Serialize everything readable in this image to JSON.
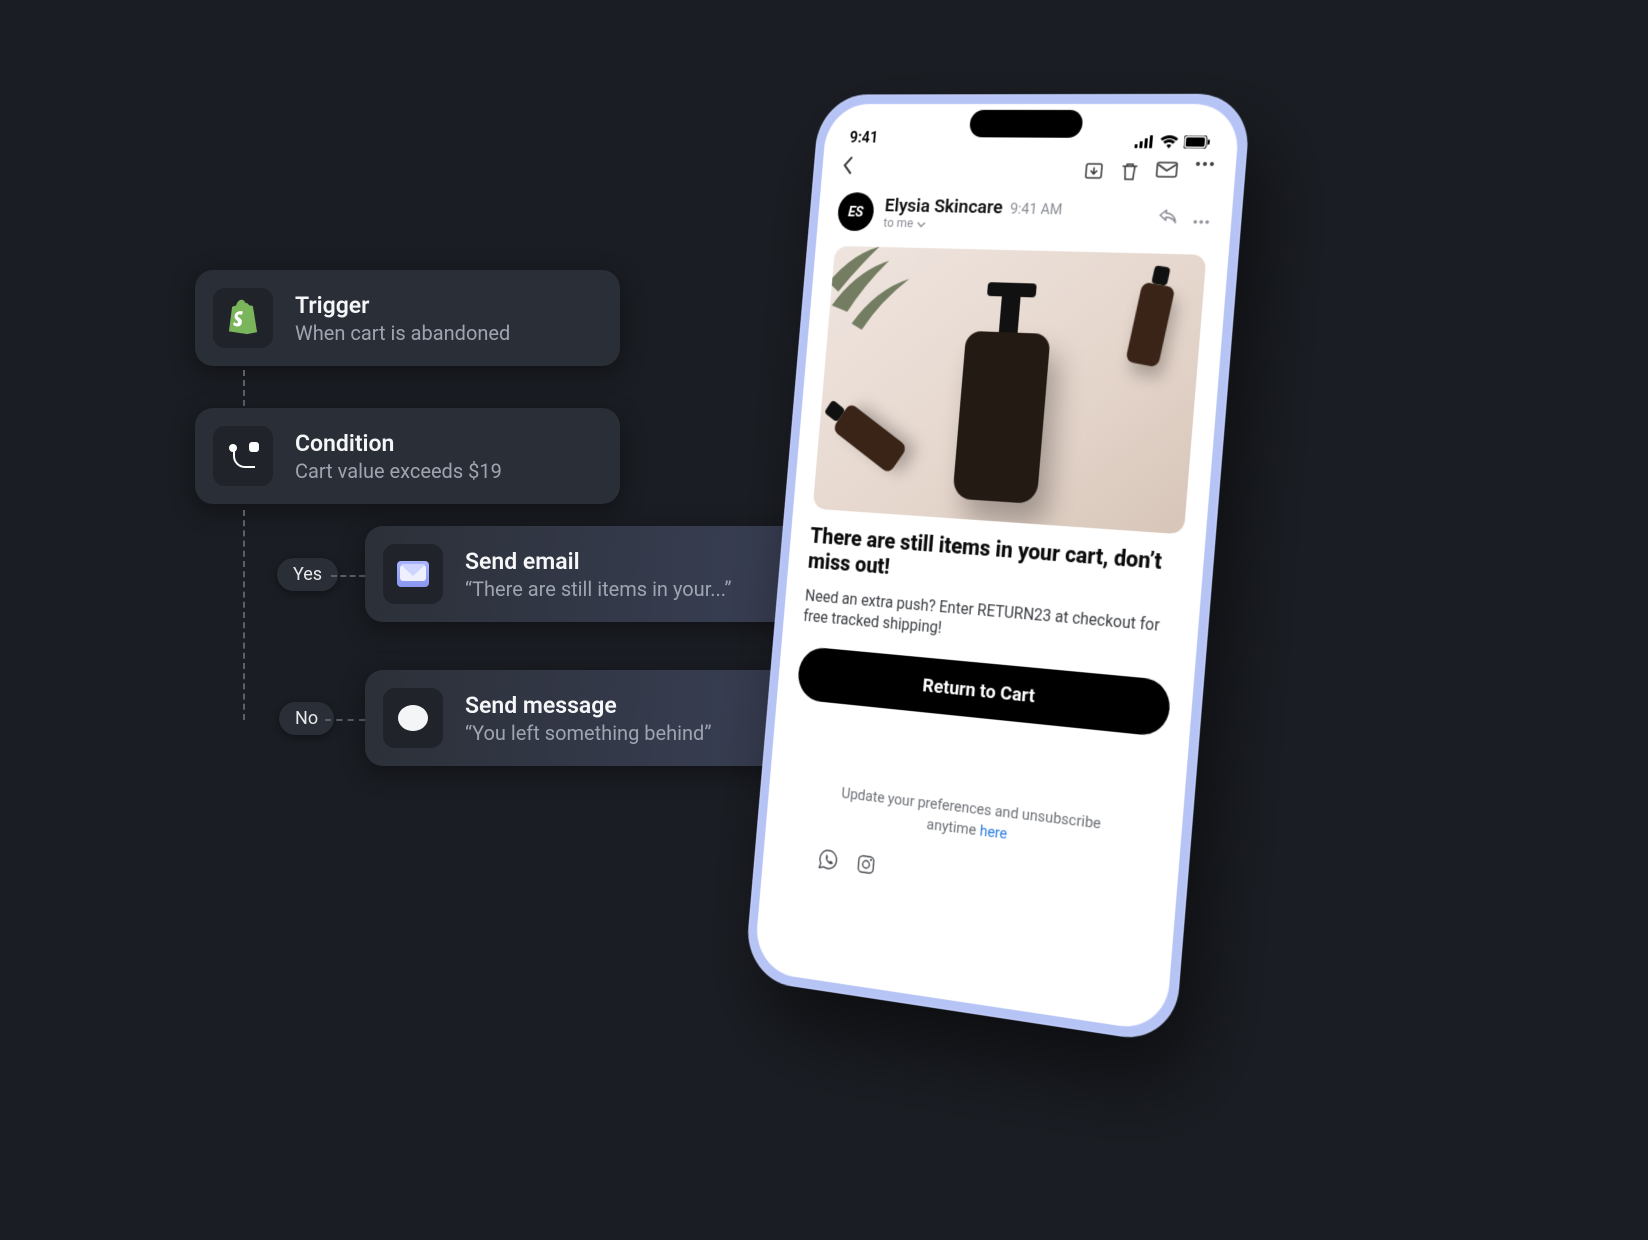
{
  "flow": {
    "trigger": {
      "title": "Trigger",
      "subtitle": "When cart is abandoned"
    },
    "condition": {
      "title": "Condition",
      "subtitle": "Cart value exceeds $19"
    },
    "branches": {
      "yes": {
        "label": "Yes",
        "action_title": "Send email",
        "action_sub": "“There are still items in your...”"
      },
      "no": {
        "label": "No",
        "action_title": "Send message",
        "action_sub": "“You left something behind”"
      }
    }
  },
  "phone": {
    "status_time": "9:41",
    "sender": "Elysia Skincare",
    "avatar": "ES",
    "time": "9:41 AM",
    "to": "to me",
    "headline": "There are still items in your cart, don’t miss out!",
    "body": "Need an extra push? Enter RETURN23 at checkout for free tracked shipping!",
    "cta": "Return to Cart",
    "footer_text": "Update your preferences and unsubscribe anytime ",
    "footer_link": "here"
  }
}
